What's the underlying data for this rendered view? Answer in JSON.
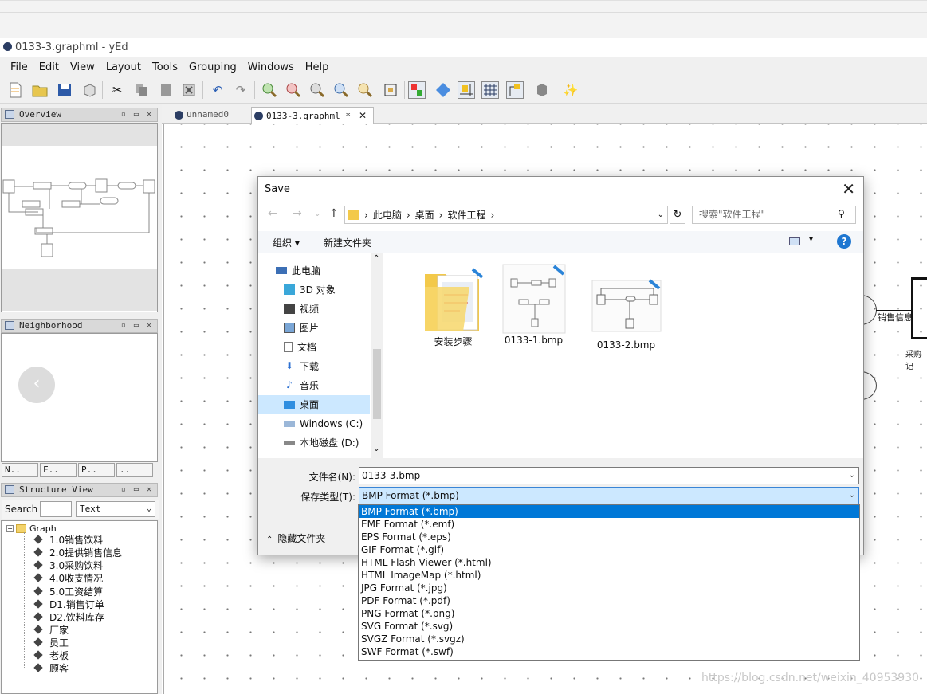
{
  "window": {
    "title": "0133-3.graphml - yEd"
  },
  "menu": [
    "File",
    "Edit",
    "View",
    "Layout",
    "Tools",
    "Grouping",
    "Windows",
    "Help"
  ],
  "panels": {
    "overview": "Overview",
    "neighborhood": "Neighborhood",
    "structure": "Structure View",
    "minitabs": [
      "N..",
      "F..",
      "P..",
      ".."
    ],
    "controls": "▫ ▭ ✕"
  },
  "structure": {
    "search_label": "Search",
    "filter_value": "Text",
    "root": "Graph",
    "items": [
      "1.0销售饮料",
      "2.0提供销售信息",
      "3.0采购饮料",
      "4.0收支情况",
      "5.0工资结算",
      "D1.销售订单",
      "D2.饮料库存",
      "厂家",
      "员工",
      "老板",
      "顾客"
    ]
  },
  "tabs": [
    {
      "label": "unnamed0",
      "active": false
    },
    {
      "label": "0133-3.graphml *",
      "active": true
    }
  ],
  "canvas": {
    "label1": "销售信息",
    "label2": "采购记"
  },
  "dialog": {
    "title": "Save",
    "close": "✕",
    "breadcrumb": [
      "此电脑",
      "桌面",
      "软件工程"
    ],
    "search_placeholder": "搜索\"软件工程\"",
    "organize": "组织 ▾",
    "new_folder": "新建文件夹",
    "help": "?",
    "nav_items": [
      "此电脑",
      "3D 对象",
      "视频",
      "图片",
      "文档",
      "下载",
      "音乐",
      "桌面",
      "Windows (C:)",
      "本地磁盘 (D:)"
    ],
    "nav_selected": "桌面",
    "files": [
      {
        "name": "安装步骤",
        "kind": "folder"
      },
      {
        "name": "0133-1.bmp",
        "kind": "image"
      },
      {
        "name": "0133-2.bmp",
        "kind": "image"
      }
    ],
    "filename_label": "文件名(N):",
    "filename_value": "0133-3.bmp",
    "filetype_label": "保存类型(T):",
    "filetype_value": "BMP Format (*.bmp)",
    "hide_folders": "隐藏文件夹",
    "filetype_options": [
      "BMP Format (*.bmp)",
      "EMF Format (*.emf)",
      "EPS Format (*.eps)",
      "GIF Format (*.gif)",
      "HTML Flash Viewer (*.html)",
      "HTML ImageMap (*.html)",
      "JPG Format (*.jpg)",
      "PDF Format (*.pdf)",
      "PNG Format (*.png)",
      "SVG Format (*.svg)",
      "SVGZ Format (*.svgz)",
      "SWF Format (*.swf)"
    ]
  },
  "watermark": "https://blog.csdn.net/weixin_40953930",
  "colors": {
    "accent": "#0078d7",
    "selection": "#cce8ff",
    "app_icon": "#2b3d63"
  }
}
